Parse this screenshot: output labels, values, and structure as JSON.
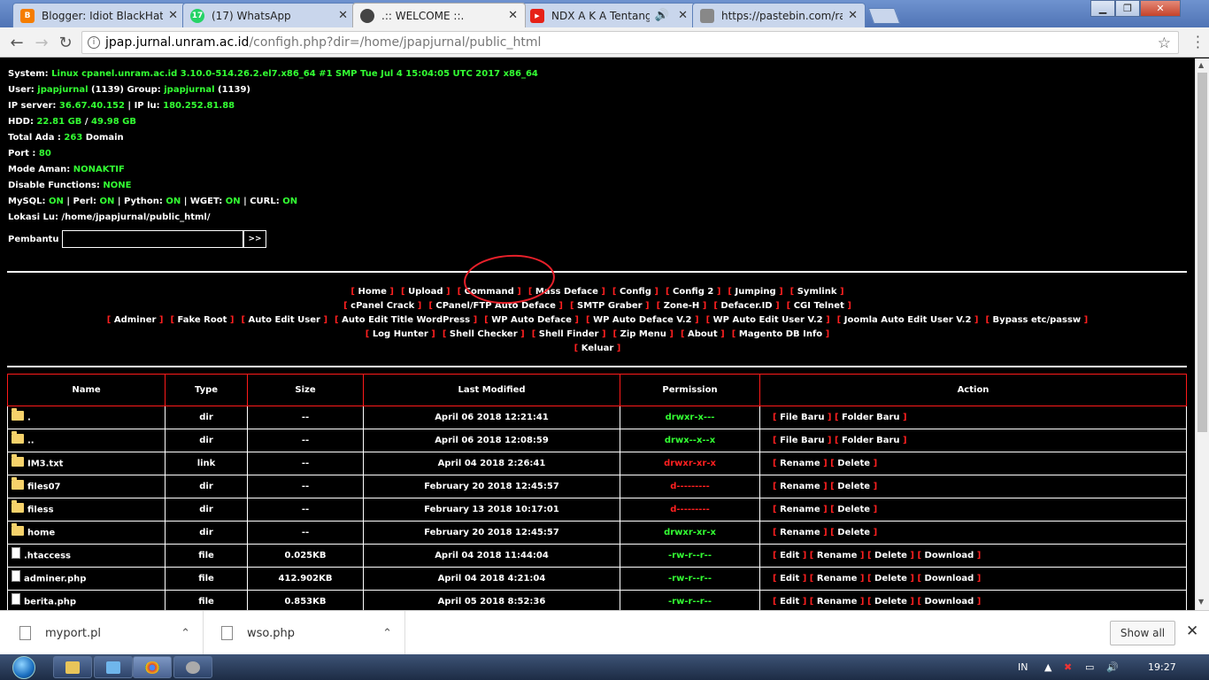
{
  "browser": {
    "tabs": [
      {
        "title": "Blogger: Idiot BlackHat -",
        "icon": "blogger-icon",
        "color": "#f57d00"
      },
      {
        "title": "(17) WhatsApp",
        "icon": "whatsapp-icon",
        "color": "#25d366",
        "badge": "17"
      },
      {
        "title": ".:: WELCOME ::.",
        "icon": "globe-icon",
        "color": "#555555"
      },
      {
        "title": "NDX A K A Tentang A",
        "icon": "youtube-icon",
        "color": "#e62117"
      },
      {
        "title": "https://pastebin.com/raw",
        "icon": "pastebin-icon",
        "color": "#666666"
      }
    ],
    "url_domain": "jpap.jurnal.unram.ac.id",
    "url_path": "/configh.php?dir=/home/jpapjurnal/public_html"
  },
  "sysinfo": {
    "system_label": "System:",
    "system_value": "Linux cpanel.unram.ac.id 3.10.0-514.26.2.el7.x86_64 #1 SMP Tue Jul 4 15:04:05 UTC 2017 x86_64",
    "user_label": "User:",
    "user_value": "jpapjurnal",
    "user_id": " (1139) Group: ",
    "group_value": "jpapjurnal",
    "group_id": " (1139)",
    "ip_label": "IP server:",
    "ip_value": "36.67.40.152",
    "ipl_label": " | IP lu: ",
    "ipl_value": "180.252.81.88",
    "hdd_label": "HDD:",
    "hdd_used": "22.81 GB",
    "hdd_sep": " / ",
    "hdd_total": "49.98 GB",
    "total_label": "Total Ada : ",
    "total_value": "263",
    "total_suffix": " Domain",
    "port_label": "Port : ",
    "port_value": "80",
    "safe_label": "Mode Aman: ",
    "safe_value": "NONAKTIF",
    "disable_label": "Disable Functions: ",
    "disable_value": "NONE",
    "mysql_label": "MySQL: ",
    "perl_label": " | Perl: ",
    "python_label": " | Python: ",
    "wget_label": " | WGET: ",
    "curl_label": " | CURL: ",
    "on": "ON",
    "location_label": "Lokasi Lu: ",
    "location_value": "/home/jpapjurnal/public_html/",
    "pembantu_label": "Pembantu :",
    "pembantu_btn": ">>"
  },
  "nav": {
    "row1": [
      "Home",
      "Upload",
      "Command",
      "Mass Deface",
      "Config",
      "Config 2",
      "Jumping",
      "Symlink"
    ],
    "row2": [
      "cPanel Crack",
      "CPanel/FTP Auto Deface",
      "SMTP Graber",
      "Zone-H",
      "Defacer.ID",
      "CGI Telnet"
    ],
    "row3": [
      "Adminer",
      "Fake Root",
      "Auto Edit User",
      "Auto Edit Title WordPress",
      "WP Auto Deface",
      "WP Auto Deface V.2",
      "WP Auto Edit User V.2",
      "Joomla Auto Edit User V.2",
      "Bypass etc/passw"
    ],
    "row4": [
      "Log Hunter",
      "Shell Checker",
      "Shell Finder",
      "Zip Menu",
      "About",
      "Magento DB Info"
    ],
    "row5": [
      "Keluar"
    ]
  },
  "table": {
    "headers": [
      "Name",
      "Type",
      "Size",
      "Last Modified",
      "Permission",
      "Action"
    ],
    "rows": [
      {
        "name": ".",
        "kind": "folder",
        "type": "dir",
        "size": "--",
        "modified": "April 06 2018 12:21:41",
        "perm": "drwxr-x---",
        "perm_color": "green",
        "actions": [
          "File Baru",
          "Folder Baru"
        ]
      },
      {
        "name": "..",
        "kind": "folder",
        "type": "dir",
        "size": "--",
        "modified": "April 06 2018 12:08:59",
        "perm": "drwx--x--x",
        "perm_color": "green",
        "actions": [
          "File Baru",
          "Folder Baru"
        ]
      },
      {
        "name": "IM3.txt",
        "kind": "folder",
        "type": "link",
        "size": "--",
        "modified": "April 04 2018 2:26:41",
        "perm": "drwxr-xr-x",
        "perm_color": "red",
        "actions": [
          "Rename",
          "Delete"
        ]
      },
      {
        "name": "files07",
        "kind": "folder",
        "type": "dir",
        "size": "--",
        "modified": "February 20 2018 12:45:57",
        "perm": "d---------",
        "perm_color": "red",
        "actions": [
          "Rename",
          "Delete"
        ]
      },
      {
        "name": "filess",
        "kind": "folder",
        "type": "dir",
        "size": "--",
        "modified": "February 13 2018 10:17:01",
        "perm": "d---------",
        "perm_color": "red",
        "actions": [
          "Rename",
          "Delete"
        ]
      },
      {
        "name": "home",
        "kind": "folder",
        "type": "dir",
        "size": "--",
        "modified": "February 20 2018 12:45:57",
        "perm": "drwxr-xr-x",
        "perm_color": "green",
        "actions": [
          "Rename",
          "Delete"
        ]
      },
      {
        "name": ".htaccess",
        "kind": "file",
        "type": "file",
        "size": "0.025KB",
        "modified": "April 04 2018 11:44:04",
        "perm": "-rw-r--r--",
        "perm_color": "green",
        "actions": [
          "Edit",
          "Rename",
          "Delete",
          "Download"
        ]
      },
      {
        "name": "adminer.php",
        "kind": "file",
        "type": "file",
        "size": "412.902KB",
        "modified": "April 04 2018 4:21:04",
        "perm": "-rw-r--r--",
        "perm_color": "green",
        "actions": [
          "Edit",
          "Rename",
          "Delete",
          "Download"
        ]
      },
      {
        "name": "berita.php",
        "kind": "file",
        "type": "file",
        "size": "0.853KB",
        "modified": "April 05 2018 8:52:36",
        "perm": "-rw-r--r--",
        "perm_color": "green",
        "actions": [
          "Edit",
          "Rename",
          "Delete",
          "Download"
        ]
      }
    ]
  },
  "downloads": {
    "items": [
      "myport.pl",
      "wso.php"
    ],
    "show_all": "Show all"
  },
  "taskbar": {
    "lang": "IN",
    "time": "19:27"
  }
}
